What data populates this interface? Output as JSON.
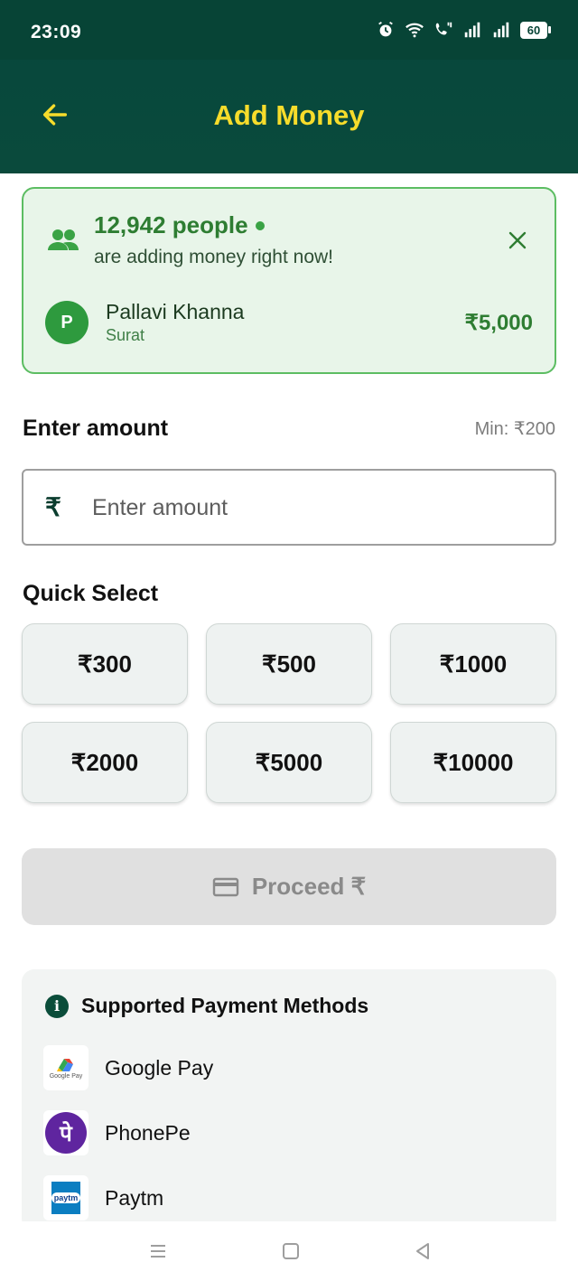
{
  "status_bar": {
    "time": "23:09",
    "battery": "60"
  },
  "header": {
    "title": "Add Money"
  },
  "live_activity": {
    "count": "12,942 people",
    "subtitle": "are adding money right now!",
    "avatar_initial": "P",
    "payer_name": "Pallavi Khanna",
    "payer_city": "Surat",
    "payer_amount": "₹5,000"
  },
  "amount": {
    "label": "Enter amount",
    "min_text": "Min: ₹200",
    "currency_symbol": "₹",
    "placeholder": "Enter amount",
    "value": ""
  },
  "quick_select": {
    "label": "Quick Select",
    "options": [
      "₹300",
      "₹500",
      "₹1000",
      "₹2000",
      "₹5000",
      "₹10000"
    ]
  },
  "proceed": {
    "label": "Proceed ₹"
  },
  "payment_methods": {
    "heading": "Supported Payment Methods",
    "items": [
      {
        "label": "Google Pay",
        "logo_text": "Google Pay"
      },
      {
        "label": "PhonePe",
        "logo_text": "पे"
      },
      {
        "label": "Paytm",
        "logo_text": "paytm"
      }
    ]
  },
  "colors": {
    "header_bg": "#074436",
    "title": "#f7dc2b",
    "live_card_bg": "#e8f5e9",
    "live_card_border": "#5cbd62",
    "accent_green": "#2e7d32",
    "proceed_disabled_bg": "#e0e0e0"
  }
}
